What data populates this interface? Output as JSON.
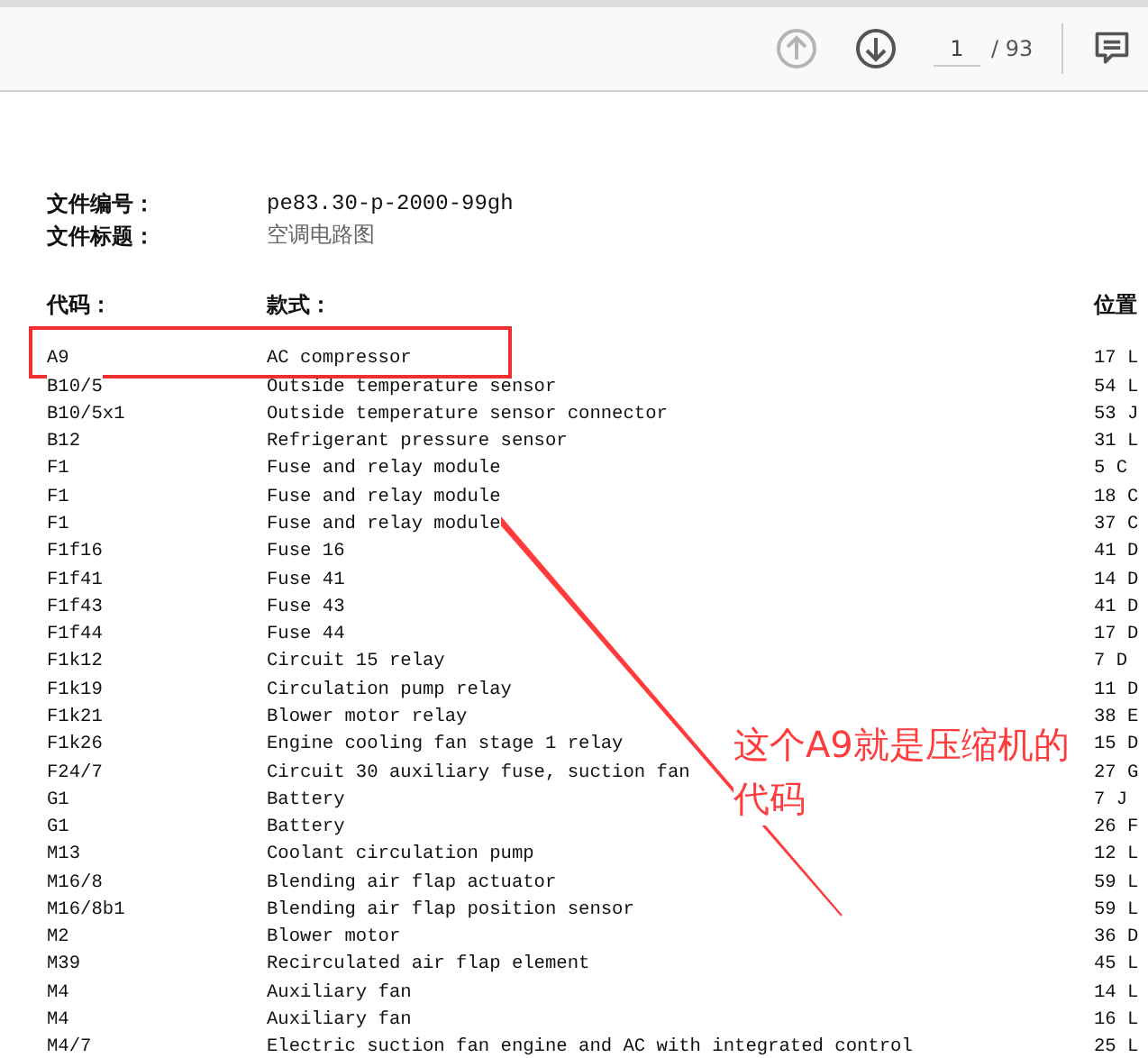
{
  "toolbar": {
    "prev_disabled": true,
    "next_disabled": false,
    "page": "1",
    "total": "/ 93"
  },
  "document": {
    "info": [
      {
        "label": "文件编号：",
        "value": "pe83.30-p-2000-99gh"
      },
      {
        "label": "文件标题：",
        "value": "空调电路图"
      }
    ],
    "columns": [
      "代码：",
      "款式：",
      "位置"
    ],
    "rows": [
      {
        "code": "A9",
        "name": "AC compressor",
        "position": "17 L",
        "highlighted": true
      },
      {
        "code": "B10/5",
        "name": "Outside temperature sensor",
        "position": "54 L",
        "highlighted": false
      },
      {
        "code": "B10/5x1",
        "name": "Outside temperature sensor connector",
        "position": "53 J",
        "highlighted": false
      },
      {
        "code": "B12",
        "name": "Refrigerant pressure sensor",
        "position": "31 L",
        "highlighted": false
      },
      {
        "code": "F1",
        "name": "Fuse and relay module",
        "position": "5 C",
        "highlighted": false
      },
      {
        "code": "F1",
        "name": "Fuse and relay module",
        "position": "18 C",
        "highlighted": false
      },
      {
        "code": "F1",
        "name": "Fuse and relay module",
        "position": "37 C",
        "highlighted": false
      },
      {
        "code": "F1f16",
        "name": "Fuse 16",
        "position": "41 D",
        "highlighted": false
      },
      {
        "code": "F1f41",
        "name": "Fuse 41",
        "position": "14 D",
        "highlighted": false
      },
      {
        "code": "F1f43",
        "name": "Fuse 43",
        "position": "41 D",
        "highlighted": false
      },
      {
        "code": "F1f44",
        "name": "Fuse 44",
        "position": "17 D",
        "highlighted": false
      },
      {
        "code": "F1k12",
        "name": "Circuit 15 relay",
        "position": "7 D",
        "highlighted": false
      },
      {
        "code": "F1k19",
        "name": "Circulation pump relay",
        "position": "11 D",
        "highlighted": false
      },
      {
        "code": "F1k21",
        "name": "Blower motor relay",
        "position": "38 E",
        "highlighted": false
      },
      {
        "code": "F1k26",
        "name": "Engine cooling fan stage 1 relay",
        "position": "15 D",
        "highlighted": false
      },
      {
        "code": "F24/7",
        "name": "Circuit 30 auxiliary fuse, suction fan",
        "position": "27 G",
        "highlighted": false
      },
      {
        "code": "G1",
        "name": "Battery",
        "position": "7 J",
        "highlighted": false
      },
      {
        "code": "G1",
        "name": "Battery",
        "position": "26 F",
        "highlighted": false
      },
      {
        "code": "M13",
        "name": "Coolant circulation pump",
        "position": "12 L",
        "highlighted": false
      },
      {
        "code": "M16/8",
        "name": "Blending air flap actuator",
        "position": "59 L",
        "highlighted": false
      },
      {
        "code": "M16/8b1",
        "name": "Blending air flap position sensor",
        "position": "59 L",
        "highlighted": false
      },
      {
        "code": "M2",
        "name": "Blower motor",
        "position": "36 D",
        "highlighted": false
      },
      {
        "code": "M39",
        "name": "Recirculated air flap element",
        "position": "45 L",
        "highlighted": false
      },
      {
        "code": "M4",
        "name": "Auxiliary fan",
        "position": "14 L",
        "highlighted": false
      },
      {
        "code": "M4",
        "name": "Auxiliary fan",
        "position": "16 L",
        "highlighted": false
      },
      {
        "code": "M4/7",
        "name": "Electric suction fan engine and AC with integrated control",
        "position": "25 L",
        "highlighted": false
      }
    ]
  },
  "annotation": {
    "lines": [
      "这个A9就是压缩机的",
      "代码"
    ]
  }
}
